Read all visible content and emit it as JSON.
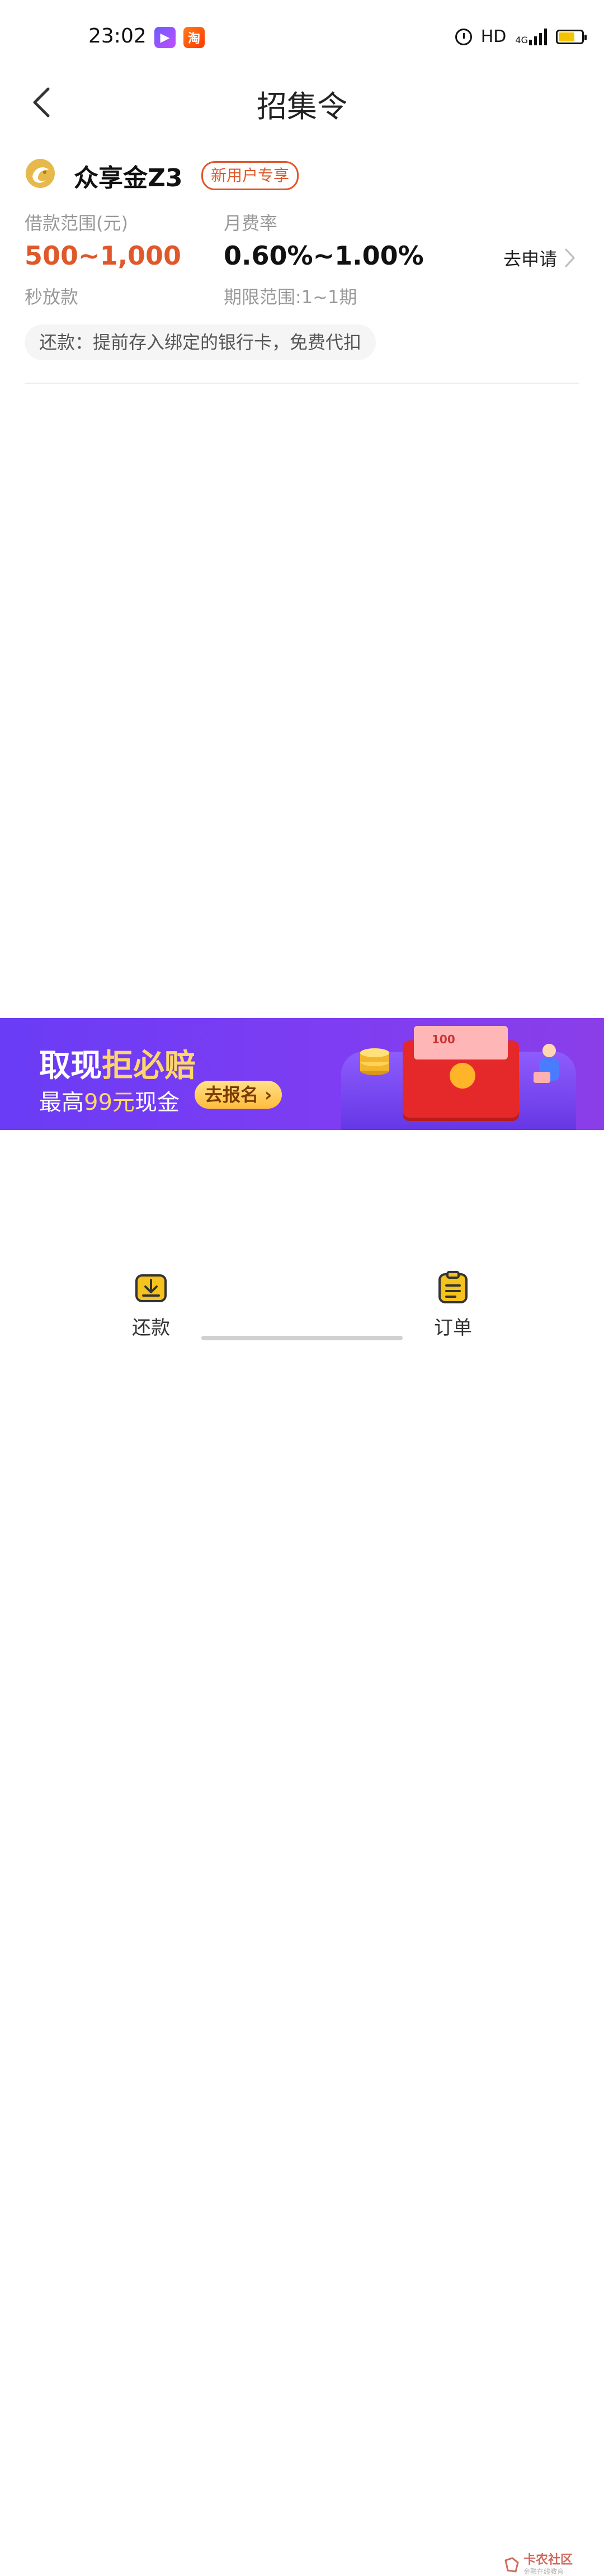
{
  "status_bar": {
    "time": "23:02",
    "app_icons": [
      "video-app-icon",
      "taobao-app-icon"
    ],
    "taobao_char": "淘",
    "hd_label": "HD",
    "network_label": "4G",
    "battery_level": 0.7
  },
  "header": {
    "title": "招集令",
    "back_icon": "chevron-left-icon"
  },
  "product": {
    "name": "众享金Z3",
    "badge": "新用户专享",
    "amount_label": "借款范围(元)",
    "amount_value": "500~1,000",
    "rate_label": "月费率",
    "rate_value": "0.60%~1.00%",
    "speed_note": "秒放款",
    "term_note": "期限范围:1~1期",
    "apply_label": "去申请",
    "repay_note": "还款：提前存入绑定的银行卡，免费代扣"
  },
  "promo": {
    "line1_prefix": "取现",
    "line1_highlight": "拒必赔",
    "line2_prefix": "最高",
    "line2_highlight": "99元",
    "line2_suffix": "现金",
    "button_label": "去报名",
    "banknote_text": "100"
  },
  "bottom_nav": {
    "items": [
      {
        "label": "还款",
        "icon": "download-tray-icon"
      },
      {
        "label": "订单",
        "icon": "clipboard-list-icon"
      }
    ]
  },
  "watermark": {
    "text": "卡农社区",
    "subtext": "金融在线教育"
  },
  "colors": {
    "accent": "#e0582a",
    "promo_bg": "#7b3df3",
    "promo_highlight": "#ffd66b",
    "nav_icon": "#f6c21c"
  }
}
